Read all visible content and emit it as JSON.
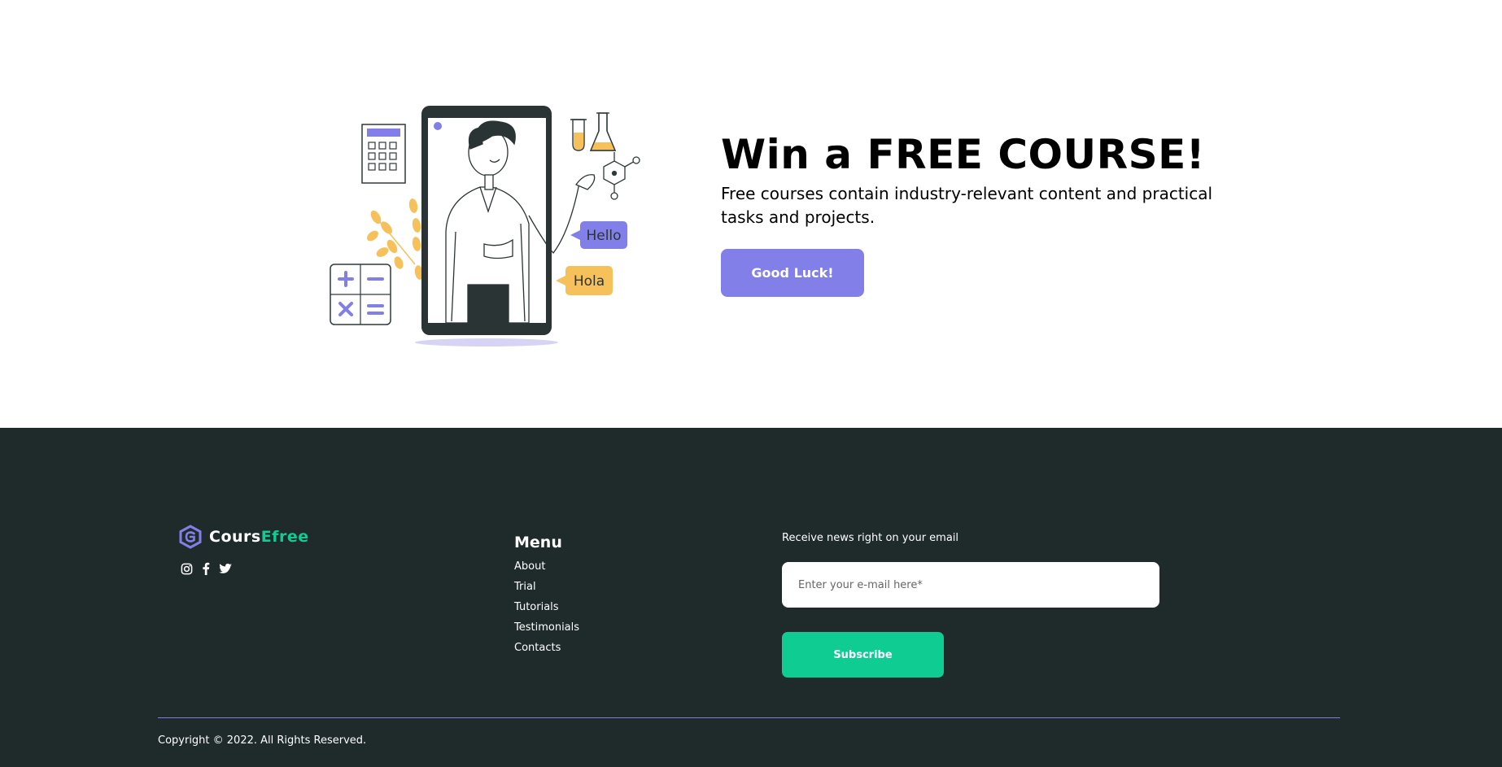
{
  "promo": {
    "title": "Win a FREE COURSE!",
    "description": "Free courses contain industry-relevant content and practical tasks and projects.",
    "button_label": "Good Luck!",
    "bubble_hello": "Hello",
    "bubble_hola": "Hola"
  },
  "footer": {
    "logo": {
      "part1": "Cours",
      "part2": "Efree"
    },
    "socials": [
      {
        "icon": "instagram-icon"
      },
      {
        "icon": "facebook-icon"
      },
      {
        "icon": "twitter-icon"
      }
    ],
    "menu": {
      "title": "Menu",
      "items": [
        "About",
        "Trial",
        "Tutorials",
        "Testimonials",
        "Contacts"
      ]
    },
    "newsletter": {
      "label": "Receive news right on your email",
      "placeholder": "Enter your e-mail here*",
      "button_label": "Subscribe"
    },
    "copyright": "Copyright © 2022. All Rights Reserved."
  },
  "colors": {
    "accent_purple": "#8280e8",
    "accent_green": "#0fcc93",
    "footer_bg": "#1f2b2b",
    "yellow": "#f6c15b"
  }
}
